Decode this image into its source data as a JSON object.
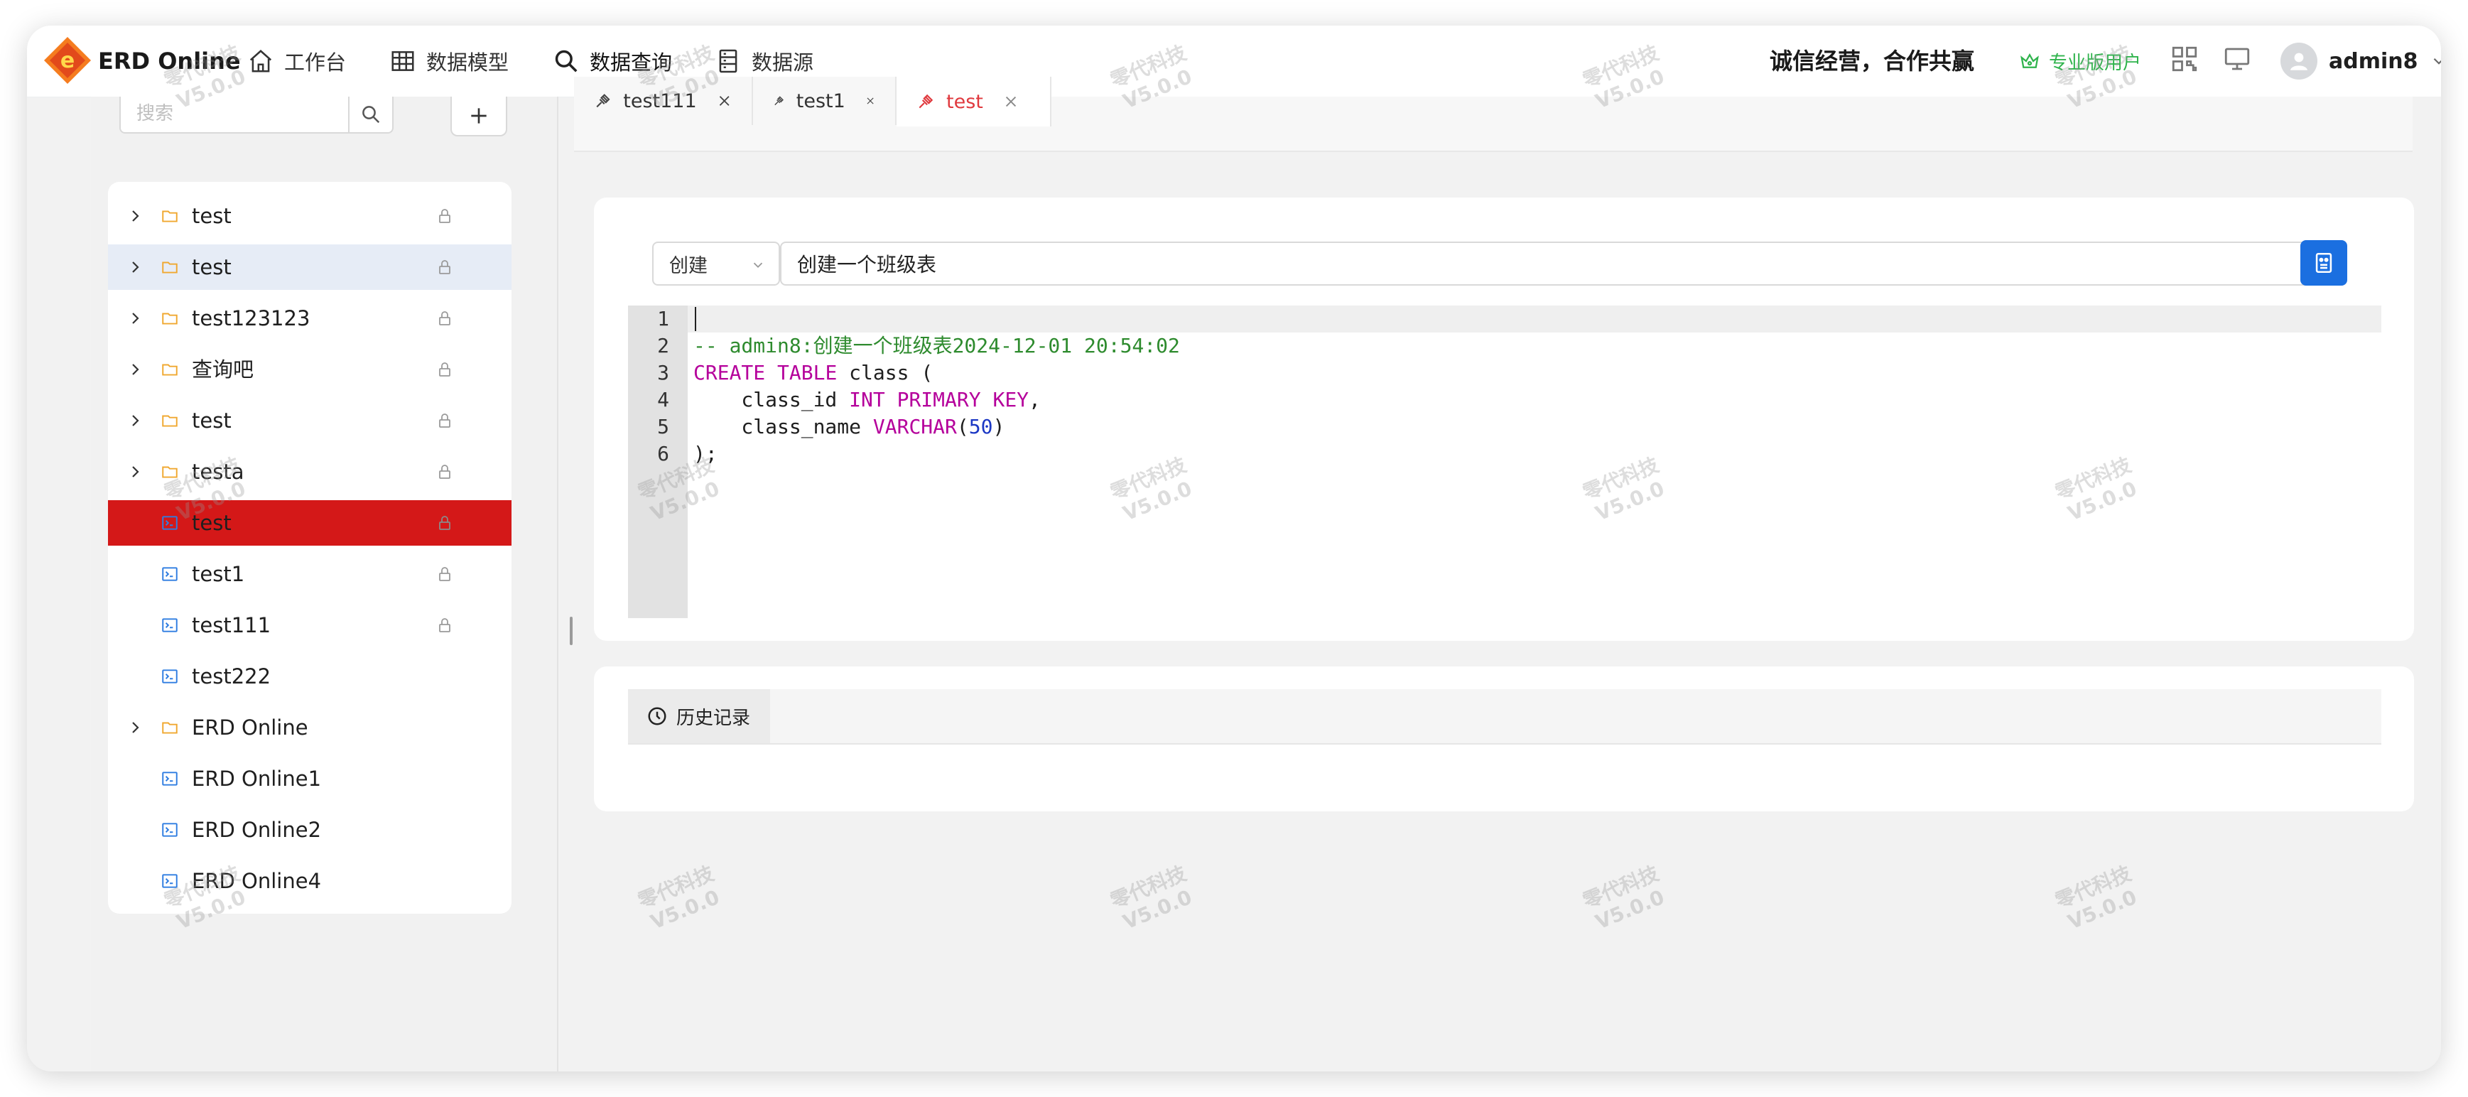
{
  "app": {
    "brand": "ERD Online",
    "slogan": "诚信经营，合作共赢",
    "pro_badge": "专业版用户",
    "username": "admin8"
  },
  "nav": [
    {
      "label": "工作台",
      "icon": "home-icon"
    },
    {
      "label": "数据模型",
      "icon": "table-icon"
    },
    {
      "label": "数据查询",
      "icon": "search-icon"
    },
    {
      "label": "数据源",
      "icon": "datasource-icon"
    }
  ],
  "sidebar": {
    "search_placeholder": "搜索",
    "tree": [
      {
        "label": "test",
        "type": "folder",
        "expandable": true,
        "locked": true
      },
      {
        "label": "test",
        "type": "folder",
        "expandable": true,
        "locked": true,
        "state": "hover"
      },
      {
        "label": "test123123",
        "type": "folder",
        "expandable": true,
        "locked": true
      },
      {
        "label": "查询吧",
        "type": "folder",
        "expandable": true,
        "locked": true
      },
      {
        "label": "test",
        "type": "folder",
        "expandable": true,
        "locked": true
      },
      {
        "label": "testa",
        "type": "folder",
        "expandable": true,
        "locked": true
      },
      {
        "label": "test",
        "type": "query",
        "expandable": false,
        "locked": true,
        "state": "selected"
      },
      {
        "label": "test1",
        "type": "query",
        "expandable": false,
        "locked": true
      },
      {
        "label": "test111",
        "type": "query",
        "expandable": false,
        "locked": true
      },
      {
        "label": "test222",
        "type": "query",
        "expandable": false,
        "locked": false
      },
      {
        "label": "ERD Online",
        "type": "folder",
        "expandable": true,
        "locked": false
      },
      {
        "label": "ERD Online1",
        "type": "query",
        "expandable": false,
        "locked": false
      },
      {
        "label": "ERD Online2",
        "type": "query",
        "expandable": false,
        "locked": false
      },
      {
        "label": "ERD Online4",
        "type": "query",
        "expandable": false,
        "locked": false
      }
    ]
  },
  "tabs": [
    {
      "label": "test111",
      "active": false
    },
    {
      "label": "test1",
      "active": false
    },
    {
      "label": "test",
      "active": true
    }
  ],
  "editor": {
    "mode": "创建",
    "prompt": "创建一个班级表",
    "lines": [
      {
        "no": "1",
        "text": ""
      },
      {
        "no": "2",
        "text": "-- admin8:创建一个班级表2024-12-01 20:54:02"
      },
      {
        "no": "3",
        "text": "CREATE TABLE class ("
      },
      {
        "no": "4",
        "text": "    class_id INT PRIMARY KEY,"
      },
      {
        "no": "5",
        "text": "    class_name VARCHAR(50)"
      },
      {
        "no": "6",
        "text": ");"
      }
    ]
  },
  "history": {
    "tab_label": "历史记录"
  },
  "watermark": {
    "line1": "零代科技",
    "line2": "V5.0.0"
  },
  "colors": {
    "accent": "#1b6fe0",
    "selected_row": "#d41818",
    "active_tab": "#e0393e",
    "pro_badge": "#2fb34c",
    "folder": "#f0a830",
    "query_icon": "#2f7de1",
    "sql_keyword": "#b5009b",
    "sql_comment": "#2e8b2e",
    "sql_number": "#1c38c4"
  }
}
